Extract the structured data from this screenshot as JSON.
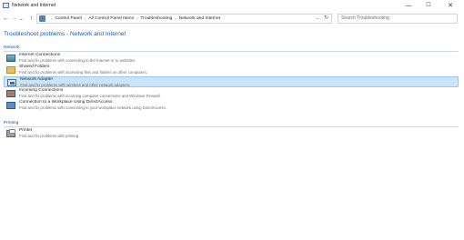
{
  "window": {
    "title": "Network and Internet",
    "controls": {
      "minimize": "—",
      "maximize": "☐",
      "close": "✕"
    }
  },
  "nav": {
    "back": "←",
    "forward": "→",
    "recent": "⌄",
    "up": "↑",
    "breadcrumbs": [
      "Control Panel",
      "All Control Panel Items",
      "Troubleshooting",
      "Network and Internet"
    ],
    "separator": "›",
    "dropdown": "⌄",
    "refresh": "↻",
    "search_placeholder": "Search Troubleshooting"
  },
  "page": {
    "title": "Troubleshoot problems - Network and Internet"
  },
  "sections": [
    {
      "header": "Network",
      "items": [
        {
          "title": "Internet Connections",
          "desc": "Find and fix problems with connecting to the Internet or to websites.",
          "icon": "internet-connections-icon",
          "selected": false
        },
        {
          "title": "Shared Folders",
          "desc": "Find and fix problems with accessing files and folders on other computers.",
          "icon": "shared-folders-icon",
          "selected": false
        },
        {
          "title": "Network Adapter",
          "desc": "Find and fix problems with wireless and other network adapters.",
          "icon": "network-adapter-icon",
          "selected": true
        },
        {
          "title": "Incoming Connections",
          "desc": "Find and fix problems with incoming computer connections and Windows Firewall.",
          "icon": "incoming-connections-icon",
          "selected": false
        },
        {
          "title": "Connection to a Workplace Using DirectAccess",
          "desc": "Find and fix problems with connecting to your workplace network using DirectAccess.",
          "icon": "directaccess-icon",
          "selected": false
        }
      ]
    },
    {
      "header": "Printing",
      "items": [
        {
          "title": "Printer",
          "desc": "Find and fix problems with printing",
          "icon": "printer-icon",
          "selected": false
        }
      ]
    }
  ]
}
